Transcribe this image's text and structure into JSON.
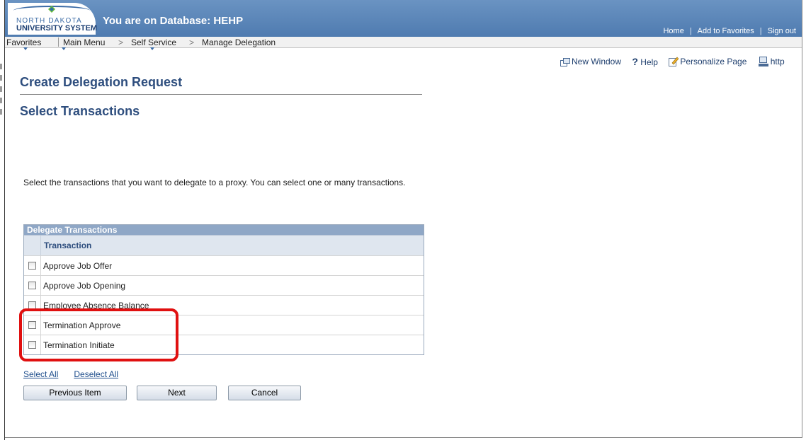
{
  "header": {
    "logo_top": "NORTH DAKOTA",
    "logo_bottom": "UNIVERSITY SYSTEM",
    "database_title": "You are on Database: HEHP",
    "links": {
      "home": "Home",
      "favorites": "Add to Favorites",
      "signout": "Sign out"
    }
  },
  "nav": {
    "favorites": "Favorites",
    "main_menu": "Main Menu",
    "self_service": "Self Service",
    "manage_delegation": "Manage Delegation",
    "sep": ">"
  },
  "page_actions": {
    "new_window": "New Window",
    "help": "Help",
    "help_glyph": "?",
    "personalize": "Personalize Page",
    "http": "http"
  },
  "page": {
    "title": "Create Delegation Request",
    "subtitle": "Select Transactions",
    "instructions": "Select the transactions that you want to delegate to a proxy. You can select one or many transactions."
  },
  "grid": {
    "caption": "Delegate Transactions",
    "column_header": "Transaction",
    "rows": [
      {
        "label": "Approve Job Offer"
      },
      {
        "label": "Approve Job Opening"
      },
      {
        "label": "Employee Absence Balance"
      },
      {
        "label": "Termination Approve"
      },
      {
        "label": "Termination Initiate"
      }
    ]
  },
  "actions": {
    "select_all": "Select All",
    "deselect_all": "Deselect All",
    "previous": "Previous Item",
    "next": "Next",
    "cancel": "Cancel"
  },
  "colors": {
    "banner": "#4f7bb0",
    "title": "#2e4e7e",
    "highlight": "#e01010",
    "grid_caption": "#8fa7c6"
  }
}
